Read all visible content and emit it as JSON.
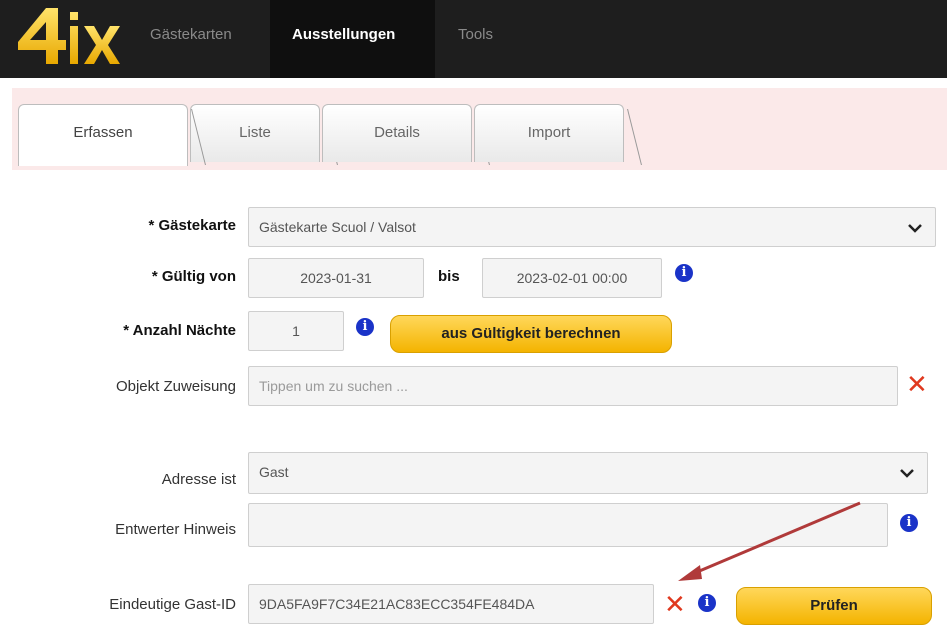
{
  "nav": {
    "logo_text": "4ix",
    "items": [
      {
        "label": "Gästekarten",
        "active": false
      },
      {
        "label": "Ausstellungen",
        "active": true
      },
      {
        "label": "Tools",
        "active": false
      }
    ]
  },
  "tabs": [
    {
      "label": "Erfassen",
      "active": true
    },
    {
      "label": "Liste",
      "active": false
    },
    {
      "label": "Details",
      "active": false
    },
    {
      "label": "Import",
      "active": false
    }
  ],
  "form": {
    "gaestekarte": {
      "label": "* Gästekarte",
      "value": "Gästekarte Scuol / Valsot"
    },
    "gueltig": {
      "label": "* Gültig von",
      "from": "2023-01-31",
      "to_label": "bis",
      "to": "2023-02-01 00:00"
    },
    "naechte": {
      "label": "* Anzahl Nächte",
      "value": "1",
      "button": "aus Gültigkeit berechnen"
    },
    "objekt": {
      "label": "Objekt Zuweisung",
      "placeholder": "Tippen um zu suchen ..."
    },
    "adresse": {
      "label": "Adresse ist",
      "value": "Gast"
    },
    "entwerter": {
      "label": "Entwerter Hinweis",
      "value": ""
    },
    "gast_id": {
      "label": "Eindeutige Gast-ID",
      "value": "9DA5FA9F7C34E21AC83ECC354FE484DA",
      "button": "Prüfen"
    }
  },
  "colors": {
    "accent_yellow": "#f4b400",
    "info_blue": "#1a33c8",
    "clear_red": "#e0391f",
    "annotation_arrow": "#b03a3a"
  }
}
